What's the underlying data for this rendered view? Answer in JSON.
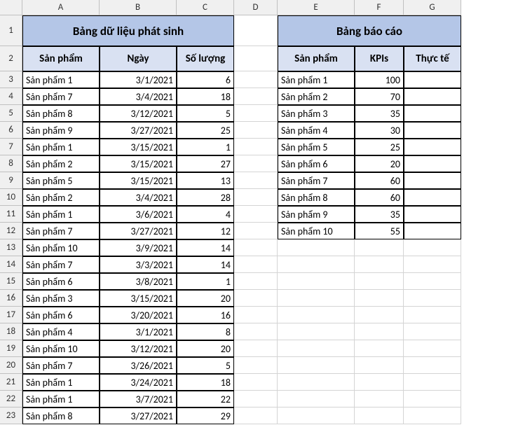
{
  "columns": [
    "A",
    "B",
    "C",
    "D",
    "E",
    "F",
    "G"
  ],
  "titles": {
    "left": "Bảng dữ liệu phát sinh",
    "right": "Bảng báo cáo"
  },
  "headers_left": [
    "Sản phẩm",
    "Ngày",
    "Số lượng"
  ],
  "headers_right": [
    "Sản phẩm",
    "KPIs",
    "Thực tế"
  ],
  "data_left": [
    {
      "sp": "Sản phẩm 1",
      "ngay": "3/1/2021",
      "sl": 6
    },
    {
      "sp": "Sản phẩm 7",
      "ngay": "3/4/2021",
      "sl": 18
    },
    {
      "sp": "Sản phẩm 8",
      "ngay": "3/12/2021",
      "sl": 5
    },
    {
      "sp": "Sản phẩm 9",
      "ngay": "3/27/2021",
      "sl": 25
    },
    {
      "sp": "Sản phẩm 1",
      "ngay": "3/15/2021",
      "sl": 1
    },
    {
      "sp": "Sản phẩm 2",
      "ngay": "3/15/2021",
      "sl": 27
    },
    {
      "sp": "Sản phẩm 5",
      "ngay": "3/15/2021",
      "sl": 13
    },
    {
      "sp": "Sản phẩm 2",
      "ngay": "3/4/2021",
      "sl": 28
    },
    {
      "sp": "Sản phẩm 1",
      "ngay": "3/6/2021",
      "sl": 4
    },
    {
      "sp": "Sản phẩm 7",
      "ngay": "3/27/2021",
      "sl": 12
    },
    {
      "sp": "Sản phẩm 10",
      "ngay": "3/9/2021",
      "sl": 14
    },
    {
      "sp": "Sản phẩm 7",
      "ngay": "3/3/2021",
      "sl": 14
    },
    {
      "sp": "Sản phẩm 6",
      "ngay": "3/8/2021",
      "sl": 1
    },
    {
      "sp": "Sản phẩm 3",
      "ngay": "3/15/2021",
      "sl": 20
    },
    {
      "sp": "Sản phẩm 6",
      "ngay": "3/20/2021",
      "sl": 16
    },
    {
      "sp": "Sản phẩm 4",
      "ngay": "3/1/2021",
      "sl": 8
    },
    {
      "sp": "Sản phẩm 10",
      "ngay": "3/12/2021",
      "sl": 20
    },
    {
      "sp": "Sản phẩm 7",
      "ngay": "3/26/2021",
      "sl": 5
    },
    {
      "sp": "Sản phẩm 1",
      "ngay": "3/24/2021",
      "sl": 18
    },
    {
      "sp": "Sản phẩm 1",
      "ngay": "3/7/2021",
      "sl": 22
    },
    {
      "sp": "Sản phẩm 8",
      "ngay": "3/27/2021",
      "sl": 29
    }
  ],
  "data_right": [
    {
      "sp": "Sản phẩm 1",
      "kpi": 100
    },
    {
      "sp": "Sản phẩm 2",
      "kpi": 70
    },
    {
      "sp": "Sản phẩm 3",
      "kpi": 35
    },
    {
      "sp": "Sản phẩm 4",
      "kpi": 30
    },
    {
      "sp": "Sản phẩm 5",
      "kpi": 25
    },
    {
      "sp": "Sản phẩm 6",
      "kpi": 20
    },
    {
      "sp": "Sản phẩm 7",
      "kpi": 60
    },
    {
      "sp": "Sản phẩm 8",
      "kpi": 60
    },
    {
      "sp": "Sản phẩm 9",
      "kpi": 35
    },
    {
      "sp": "Sản phẩm 10",
      "kpi": 55
    }
  ],
  "row_count": 23
}
